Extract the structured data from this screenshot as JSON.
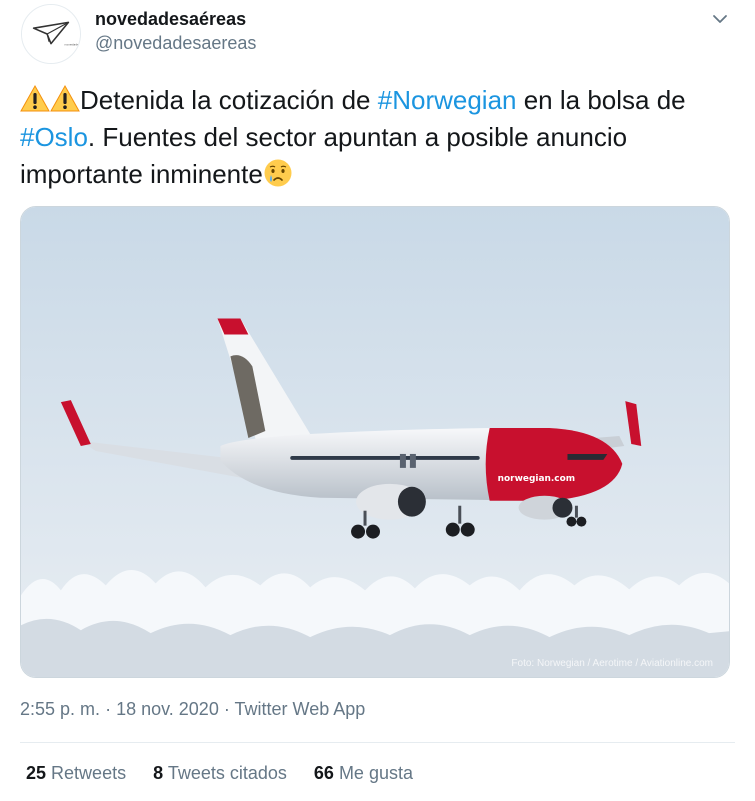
{
  "user": {
    "display_name": "novedadesaéreas",
    "handle": "@novedadesaereas"
  },
  "tweet": {
    "text_part1": "Detenida la cotización de ",
    "hashtag1": "#Norwegian",
    "text_part2": " en la bolsa de ",
    "hashtag2": "#Oslo",
    "text_part3": ". Fuentes del sector apuntan a posible anuncio importante inminente",
    "leading_emojis": [
      "warning-icon",
      "warning-icon"
    ],
    "trailing_emoji": "crying-face-icon"
  },
  "media": {
    "photo_credit": "Foto: Norwegian / Aerotime / Aviationline.com"
  },
  "meta": {
    "time": "2:55 p. m.",
    "separator": "·",
    "date": "18 nov. 2020",
    "source": "Twitter Web App"
  },
  "stats": {
    "retweets_count": "25",
    "retweets_label": "Retweets",
    "quotes_count": "8",
    "quotes_label": "Tweets citados",
    "likes_count": "66",
    "likes_label": "Me gusta"
  },
  "colors": {
    "hashtag": "#1b95e0",
    "secondary_text": "#657786",
    "livery_red": "#c8102e"
  }
}
